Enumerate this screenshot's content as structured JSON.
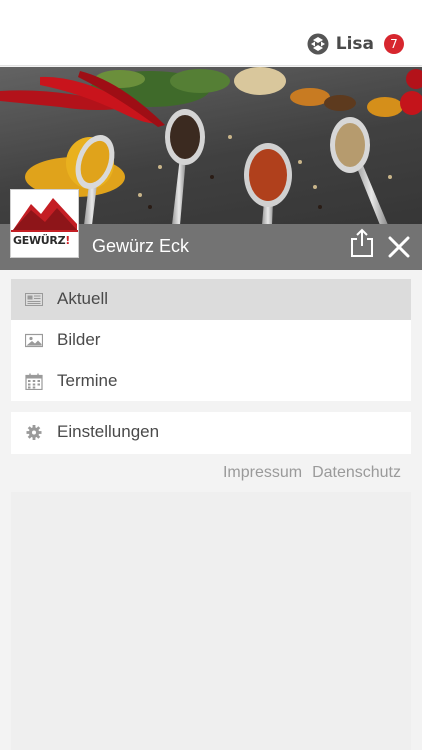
{
  "header": {
    "app_icon": "app-logo-icon",
    "user_name": "Lisa",
    "notification_count": "7",
    "badge_color": "#d7262e"
  },
  "hero": {
    "image": "spices-on-spoons-photo"
  },
  "brand": {
    "logo_text": "GEWÜRZ",
    "logo_exclaim": "!",
    "title": "Gewürz Eck",
    "share_icon": "share-icon",
    "close_icon": "close-icon",
    "title_bar_color": "#737373"
  },
  "menu": {
    "items": [
      {
        "label": "Aktuell",
        "icon": "newspaper-icon",
        "active": true
      },
      {
        "label": "Bilder",
        "icon": "image-icon",
        "active": false
      },
      {
        "label": "Termine",
        "icon": "calendar-icon",
        "active": false
      }
    ],
    "settings": {
      "label": "Einstellungen",
      "icon": "gear-icon"
    }
  },
  "footer": {
    "impressum": "Impressum",
    "datenschutz": "Datenschutz"
  }
}
